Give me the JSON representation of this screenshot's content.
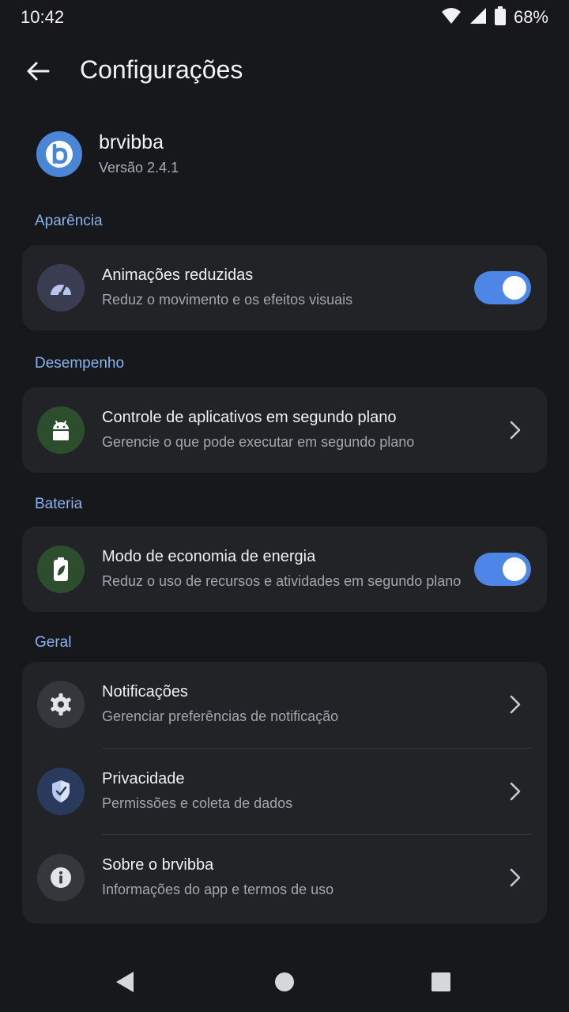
{
  "status": {
    "time": "10:42",
    "battery_pct": "68%"
  },
  "header": {
    "title": "Configurações"
  },
  "app": {
    "name": "brvibba",
    "version": "Versão 2.4.1",
    "logo_letter": "b"
  },
  "sections": {
    "appearance": {
      "label": "Aparência",
      "reduced_animations": {
        "title": "Animações reduzidas",
        "subtitle": "Reduz o movimento e os efeitos visuais",
        "enabled": true
      }
    },
    "performance": {
      "label": "Desempenho",
      "background_control": {
        "title": "Controle de aplicativos em segundo plano",
        "subtitle": "Gerencie o que pode executar em segundo plano"
      }
    },
    "battery": {
      "label": "Bateria",
      "power_saving": {
        "title": "Modo de economia de energia",
        "subtitle": "Reduz o uso de recursos e atividades em segundo plano",
        "enabled": true
      }
    },
    "general": {
      "label": "Geral",
      "items": [
        {
          "title": "Notificações",
          "subtitle": "Gerenciar preferências de notificação",
          "icon": "gear-icon"
        },
        {
          "title": "Privacidade",
          "subtitle": "Permissões e coleta de dados",
          "icon": "shield-icon"
        },
        {
          "title": "Sobre o brvibba",
          "subtitle": "Informações do app e termos de uso",
          "icon": "info-icon"
        }
      ]
    }
  },
  "colors": {
    "background": "#17181b",
    "card": "#222327",
    "accent": "#4d86e6",
    "section_label": "#87b3f0"
  }
}
